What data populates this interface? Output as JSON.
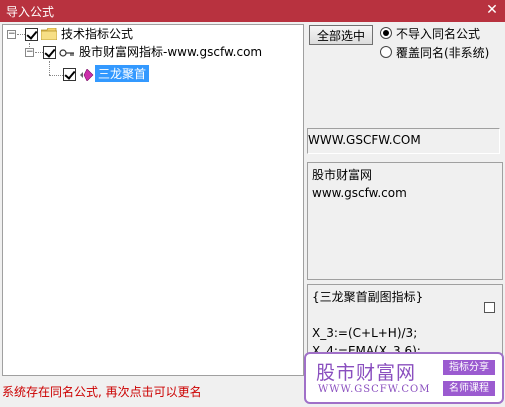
{
  "window": {
    "title": "导入公式",
    "close_glyph": "✕"
  },
  "tree": {
    "root_label": "技术指标公式",
    "group_label": "股市财富网指标-www.gscfw.com",
    "item_label": "三龙聚首"
  },
  "options": {
    "select_all_label": "全部选中",
    "radio_skip_label": "不导入同名公式",
    "radio_overwrite_label": "覆盖同名(非系统)"
  },
  "info": {
    "url_text": "WWW.GSCFW.COM",
    "desc_lines": [
      "股市财富网",
      "www.gscfw.com"
    ],
    "code_lines": [
      "{三龙聚首副图指标}",
      "",
      "X_3:=(C+L+H)/3;",
      "X_4:=EMA(X_3,6);"
    ]
  },
  "status_text": "系统存在同名公式, 再次点击可以更名",
  "watermark": {
    "name": "股市财富网",
    "url": "WWW.GSCFW.COM",
    "tag1": "指标分享",
    "tag2": "名师课程"
  },
  "colors": {
    "titlebar": "#b8323f",
    "selection": "#3399ff",
    "status": "#cc0000",
    "watermark": "#8a4fbf"
  }
}
